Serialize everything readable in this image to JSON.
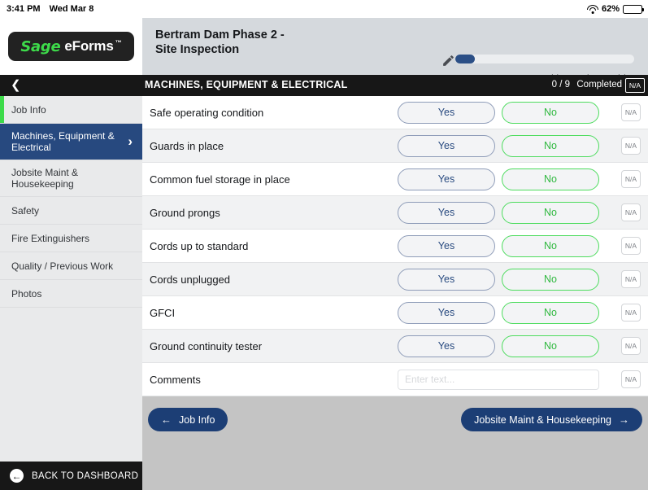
{
  "statusbar": {
    "time": "3:41 PM",
    "date": "Wed Mar 8",
    "wifi_icon": "wifi-icon",
    "battery_percent": "62%",
    "battery_icon": "battery-icon"
  },
  "brand": {
    "sage": "Sage",
    "eforms": "eForms",
    "tm": "™"
  },
  "header": {
    "form_title": "Bertram Dam Phase 2 - Site Inspection",
    "edit_icon": "pencil-icon",
    "progress_percent": 11,
    "logged_in": "Logged in as Alex Fedrico"
  },
  "section": {
    "back_icon": "chevron-left-icon",
    "title": "MACHINES, EQUIPMENT & ELECTRICAL",
    "count": "0 / 9",
    "completed_label": "Completed",
    "na_label": "N/A"
  },
  "sidebar": {
    "items": [
      {
        "label": "Job Info",
        "active": false,
        "accent": true
      },
      {
        "label": "Machines, Equipment & Electrical",
        "active": true,
        "accent": false
      },
      {
        "label": "Jobsite Maint & Housekeeping",
        "active": false,
        "accent": false
      },
      {
        "label": "Safety",
        "active": false,
        "accent": false
      },
      {
        "label": "Fire Extinguishers",
        "active": false,
        "accent": false
      },
      {
        "label": "Quality / Previous Work",
        "active": false,
        "accent": false
      },
      {
        "label": "Photos",
        "active": false,
        "accent": false
      }
    ],
    "chevron_icon": "chevron-right-icon"
  },
  "checklist": {
    "yes_label": "Yes",
    "no_label": "No",
    "na_label": "N/A",
    "rows": [
      {
        "label": "Safe operating condition"
      },
      {
        "label": "Guards in place"
      },
      {
        "label": "Common fuel storage in place"
      },
      {
        "label": "Ground prongs"
      },
      {
        "label": "Cords up to standard"
      },
      {
        "label": "Cords unplugged"
      },
      {
        "label": "GFCI"
      },
      {
        "label": "Ground continuity tester"
      }
    ],
    "comments": {
      "label": "Comments",
      "value": "",
      "placeholder": "Enter text...",
      "na_label": "N/A"
    }
  },
  "footer": {
    "prev_label": "Job Info",
    "prev_icon": "arrow-left-icon",
    "next_label": "Jobsite Maint & Housekeeping",
    "next_icon": "arrow-right-icon"
  },
  "bottombar": {
    "label": "BACK TO DASHBOARD",
    "icon": "back-circle-icon"
  },
  "colors": {
    "accent_green": "#3ddb4a",
    "navy": "#1c3e75",
    "sidebar_active": "#27497f",
    "no_green": "#2fb83f",
    "header_black": "#171717"
  }
}
